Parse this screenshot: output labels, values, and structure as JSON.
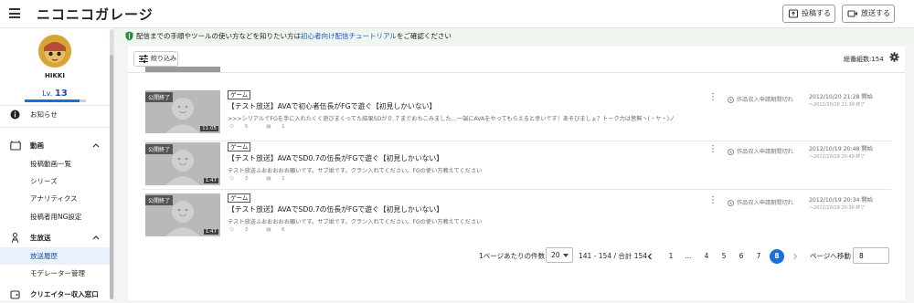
{
  "header": {
    "logo": "ニコニコガレージ",
    "post_button": "投稿する",
    "live_button": "放送する"
  },
  "sidebar": {
    "username": "HIKKI",
    "level_prefix": "Lv.",
    "level": "13",
    "level_progress": 0.9,
    "items": [
      {
        "label": "お知らせ"
      },
      {
        "label": "動画"
      },
      {
        "label": "投稿動画一覧"
      },
      {
        "label": "シリーズ"
      },
      {
        "label": "アナリティクス"
      },
      {
        "label": "投稿者用NG設定"
      },
      {
        "label": "生放送"
      },
      {
        "label": "放送履歴"
      },
      {
        "label": "モデレーター管理"
      },
      {
        "label": "クリエイター収入窓口"
      }
    ]
  },
  "notice": {
    "text_before": "配信までの手順やツールの使い方などを知りたい方は",
    "link": "初心者向け配信チュートリアル",
    "text_after": "をご確認ください"
  },
  "toolbar": {
    "filter_label": "絞り込み",
    "total_label": "総番組数:154"
  },
  "rows": [
    {
      "badge": "公開終了",
      "duration": "11:05",
      "genre": "ゲーム",
      "title": "【テスト放送】AVAで初心者伍長がFGで遊ぐ【初見しかいない】",
      "description": ">>>シリアルでFGを手に入れたくく遊びまくってた結果SDが０.７までおちこみました…一端にAVAをやってもらえると幸いです！あそびましょ？トーク力は皆無ヽ(・ヤ・)ノ",
      "visitors": "5",
      "comments": "1",
      "monetization": "作品収入申請期間切れ",
      "start": "2012/10/20 21:28 開始",
      "end": "〜2012/10/20 21:39 終了"
    },
    {
      "badge": "公開終了",
      "duration": "1:47",
      "genre": "ゲーム",
      "title": "【テスト放送】AVAでSD0.7の伍長がFGで遊ぐ【初見しかいない】",
      "description": "テスト放送ふおおおおお願いです。サブ垢です。クラン入れてください。FGの使い方教えてください",
      "visitors": "3",
      "comments": "1",
      "monetization": "作品収入申請期間切れ",
      "start": "2012/10/19 20:48 開始",
      "end": "〜2012/10/19 20:49 終了"
    },
    {
      "badge": "公開終了",
      "duration": "1:47",
      "genre": "ゲーム",
      "title": "【テスト放送】AVAでSD0.7の伍長がFGで遊ぐ【初見しかいない】",
      "description": "テスト放送ふおおおおお願いです。サブ垢です。クラン入れてください。FGの使い方教えてください",
      "visitors": "3",
      "comments": "6",
      "monetization": "作品収入申請期間切れ",
      "start": "2012/10/19 20:34 開始",
      "end": "〜2012/10/19 20:36 終了"
    }
  ],
  "pagination": {
    "per_page_label": "1ページあたりの件数",
    "per_page_value": "20",
    "range": "141 - 154 / 合計 154",
    "pages": [
      "1",
      "...",
      "4",
      "5",
      "6",
      "7",
      "8"
    ],
    "current": "8",
    "jump_label": "ページへ移動",
    "jump_value": "8"
  },
  "colors": {
    "accent": "#1a6fd9",
    "notice_bg": "#eef6ef",
    "link": "#1a55b8"
  }
}
